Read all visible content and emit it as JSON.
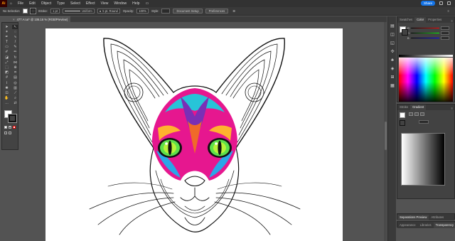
{
  "app": {
    "logo_text": "Ai"
  },
  "menu": [
    "File",
    "Edit",
    "Object",
    "Type",
    "Select",
    "Effect",
    "View",
    "Window",
    "Help"
  ],
  "topbar": {
    "share_label": "Share"
  },
  "control_bar": {
    "selection_text": "No Selection",
    "stroke_label": "Stroke:",
    "stroke_value": "1 pt",
    "brush_label": "Uniform",
    "brush_value": "5 pt. Round",
    "opacity_label": "Opacity:",
    "opacity_value": "100%",
    "style_label": "Style:",
    "doc_setup_label": "Document Setup",
    "preferences_label": "Preferences"
  },
  "document_tab": {
    "title": "477.AI.ai* @ 106.16 % (RGB/Preview)"
  },
  "color_panel": {
    "tabs": [
      "Swatches",
      "Color",
      "Properties"
    ],
    "active_tab": "Color",
    "channels": [
      {
        "label": "R",
        "color": "#ff4444"
      },
      {
        "label": "G",
        "color": "#44ff44"
      },
      {
        "label": "B",
        "color": "#4488ff"
      }
    ]
  },
  "gradient_panel": {
    "tabs": [
      "Stroke",
      "Gradient"
    ],
    "active_tab": "Gradient"
  },
  "bottom_panels": {
    "row1": [
      "Separations Preview",
      "Attributes"
    ],
    "row2": [
      "Appearance",
      "Libraries",
      "Transparency"
    ]
  },
  "colors": {
    "accent": "#1473e6",
    "app_logo": "#ff9a00",
    "canvas_bg": "#535353",
    "panel_bg": "#424242"
  }
}
